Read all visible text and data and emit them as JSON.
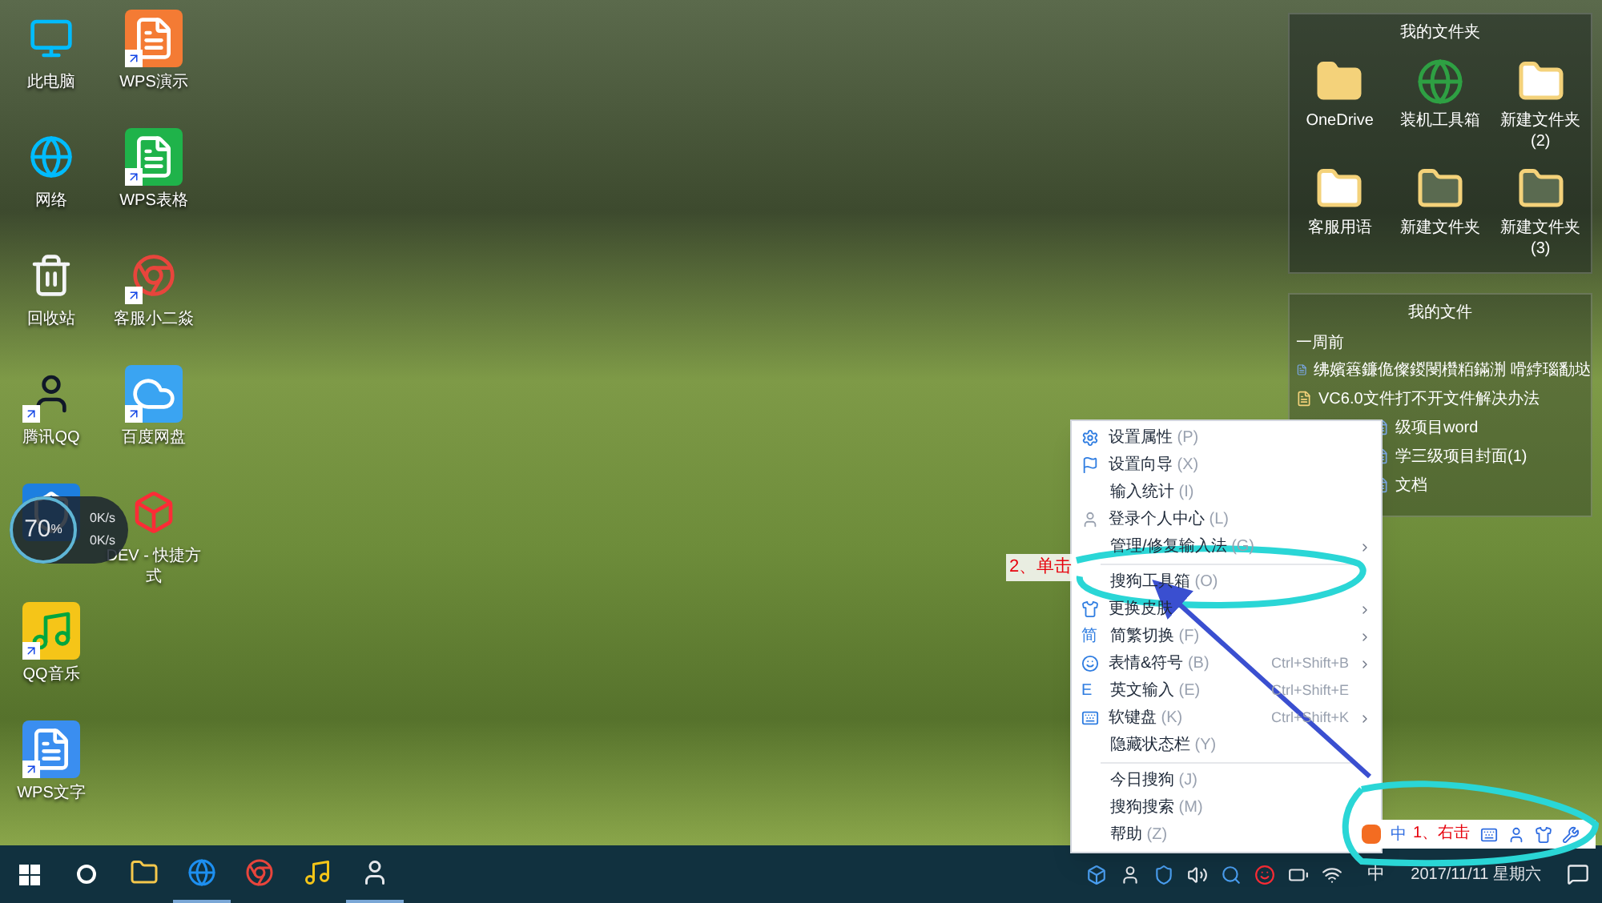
{
  "desktop": {
    "column_1": [
      {
        "label": "此电脑",
        "kind": "computer",
        "shortcut": false
      },
      {
        "label": "网络",
        "kind": "network",
        "shortcut": false
      },
      {
        "label": "回收站",
        "kind": "recycle",
        "shortcut": false
      },
      {
        "label": "腾讯QQ",
        "kind": "penguin",
        "shortcut": true
      },
      {
        "kind": "shield",
        "shortcut": false
      },
      {
        "label": "QQ音乐",
        "kind": "music",
        "shortcut": true
      },
      {
        "label": "WPS文字",
        "kind": "writer",
        "shortcut": true
      }
    ],
    "column_2": [
      {
        "label": "WPS演示",
        "kind": "slides",
        "shortcut": true
      },
      {
        "label": "WPS表格",
        "kind": "sheet",
        "shortcut": true
      },
      {
        "label": "客服小二焱",
        "kind": "browser",
        "shortcut": true
      },
      {
        "label": "百度网盘",
        "kind": "cloud",
        "shortcut": true
      },
      {
        "label": "DEV - 快捷方式",
        "kind": "tool",
        "shortcut": false
      }
    ]
  },
  "speed_widget": {
    "percent": "70",
    "unit": "%",
    "up": "0K/s",
    "down": "0K/s"
  },
  "folder_fence": {
    "title": "我的文件夹",
    "items": [
      {
        "label": "OneDrive",
        "kind": "folder"
      },
      {
        "label": "装机工具箱",
        "kind": "globe"
      },
      {
        "label": "新建文件夹 (2)",
        "kind": "doc-folder"
      },
      {
        "label": "客服用语",
        "kind": "doc-folder"
      },
      {
        "label": "新建文件夹",
        "kind": "photo-folder"
      },
      {
        "label": "新建文件夹 (3)",
        "kind": "photo-folder"
      }
    ]
  },
  "file_fence": {
    "title": "我的文件",
    "group": "一周前",
    "items": [
      {
        "label": "绋嬪簭鐮佹儏鍐閿欑粨鏋渆 嗗綍瑙勫垯",
        "kind": "doc"
      },
      {
        "label": "VC6.0文件打不开文件解决办法",
        "kind": "zip"
      },
      {
        "label": "级项目word",
        "kind": "doc"
      },
      {
        "label": "学三级项目封面(1)",
        "kind": "doc"
      },
      {
        "label": "文档",
        "kind": "doc"
      }
    ]
  },
  "context_menu": {
    "items": [
      {
        "label": "设置属性",
        "key": "(P)",
        "kind": "gear",
        "submenu": false,
        "divider_after": false
      },
      {
        "label": "设置向导",
        "key": "(X)",
        "kind": "flag",
        "submenu": false,
        "divider_after": false
      },
      {
        "label": "输入统计",
        "key": "(I)",
        "kind": "plain",
        "submenu": false,
        "divider_after": false
      },
      {
        "label": "登录个人中心",
        "key": "(L)",
        "kind": "user",
        "submenu": false,
        "divider_after": false
      },
      {
        "label": "管理/修复输入法",
        "key": "(G)",
        "kind": "plain",
        "submenu": true,
        "divider_after": true
      },
      {
        "label": "搜狗工具箱",
        "key": "(O)",
        "kind": "plain",
        "submenu": false,
        "divider_after": false
      },
      {
        "label": "更换皮肤",
        "kind": "skin",
        "submenu": true,
        "divider_after": false
      },
      {
        "label": "简繁切换",
        "key": "(F)",
        "kind": "glyph",
        "glyph": "简",
        "submenu": true,
        "divider_after": false
      },
      {
        "label": "表情&符号",
        "key": "(B)",
        "kind": "smile",
        "shortcut": "Ctrl+Shift+B",
        "submenu": true,
        "divider_after": false
      },
      {
        "label": "英文输入",
        "key": "(E)",
        "kind": "glyph",
        "glyph": "E",
        "shortcut": "Ctrl+Shift+E",
        "submenu": false,
        "divider_after": false
      },
      {
        "label": "软键盘",
        "key": "(K)",
        "kind": "keyboard",
        "shortcut": "Ctrl+Shift+K",
        "submenu": true,
        "divider_after": false
      },
      {
        "label": "隐藏状态栏",
        "key": "(Y)",
        "kind": "plain",
        "submenu": false,
        "divider_after": true
      },
      {
        "label": "今日搜狗",
        "key": "(J)",
        "kind": "plain",
        "submenu": false,
        "divider_after": false
      },
      {
        "label": "搜狗搜索",
        "key": "(M)",
        "kind": "plain",
        "submenu": false,
        "divider_after": false
      },
      {
        "label": "帮助",
        "key": "(Z)",
        "kind": "plain",
        "submenu": false,
        "divider_after": false
      }
    ]
  },
  "ime_bar": {
    "mode": "中"
  },
  "annotations": [
    {
      "text": "2、单击"
    },
    {
      "text": "1、右击"
    }
  ],
  "taskbar": {
    "apps": [
      {
        "kind": "explorer",
        "running": false
      },
      {
        "kind": "edge",
        "running": true
      },
      {
        "kind": "browser",
        "running": false
      },
      {
        "kind": "music",
        "running": false
      },
      {
        "kind": "penguin",
        "running": true
      }
    ],
    "ime": "中",
    "date": "2017/11/11 星期六"
  }
}
